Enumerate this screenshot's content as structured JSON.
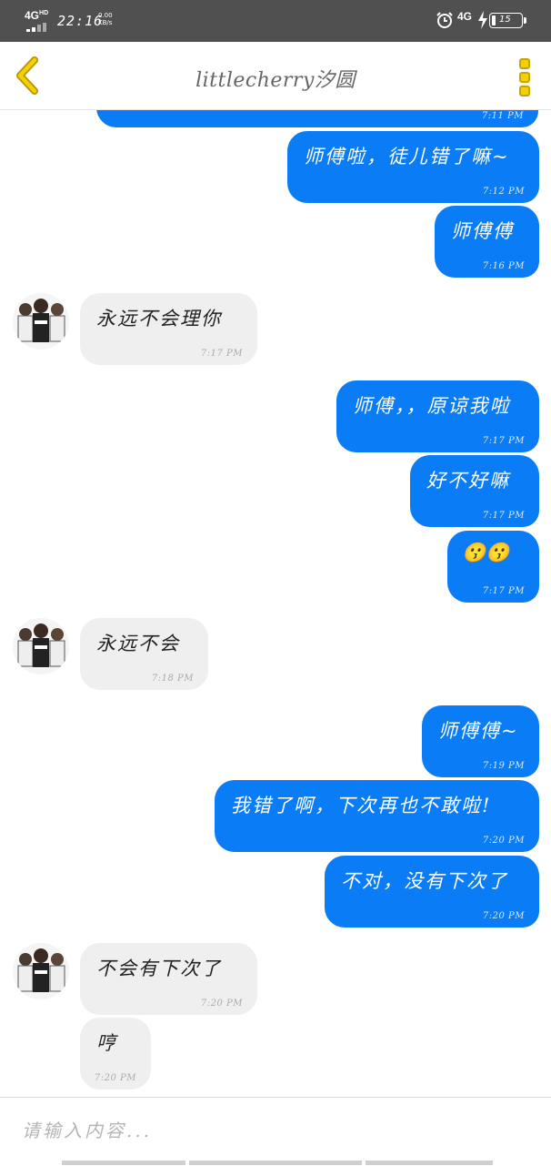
{
  "status_bar": {
    "network": "4G",
    "network_sup": "HD",
    "time": "22:16",
    "speed_value": "0.00",
    "speed_unit": "KB/s",
    "network_right": "4G",
    "battery_level": "15"
  },
  "header": {
    "title": "littlecherry汐圆"
  },
  "messages": [
    {
      "direction": "out",
      "text": "",
      "time": "7:11 PM"
    },
    {
      "direction": "out",
      "text": "师傅啦，徒儿错了嘛~",
      "time": "7:12 PM"
    },
    {
      "direction": "out",
      "text": "师傅傅",
      "time": "7:16 PM"
    },
    {
      "direction": "in",
      "text": "永远不会理你",
      "time": "7:17 PM"
    },
    {
      "direction": "out",
      "text": "师傅，，原谅我啦",
      "time": "7:17 PM"
    },
    {
      "direction": "out",
      "text": "好不好嘛",
      "time": "7:17 PM"
    },
    {
      "direction": "out",
      "text": "😗😗",
      "time": "7:17 PM"
    },
    {
      "direction": "in",
      "text": "永远不会",
      "time": "7:18 PM"
    },
    {
      "direction": "out",
      "text": "师傅傅~",
      "time": "7:19 PM"
    },
    {
      "direction": "out",
      "text": "我错了啊，下次再也不敢啦!",
      "time": "7:20 PM"
    },
    {
      "direction": "out",
      "text": "不对，没有下次了",
      "time": "7:20 PM"
    },
    {
      "direction": "in",
      "text": "不会有下次了",
      "time": "7:20 PM"
    },
    {
      "direction": "in",
      "text": "哼",
      "time": "7:20 PM"
    }
  ],
  "input": {
    "placeholder": "请输入内容...",
    "value": ""
  },
  "colors": {
    "outgoing_bubble": "#0a7cf5",
    "incoming_bubble": "#efefef",
    "accent": "#f4d000"
  }
}
